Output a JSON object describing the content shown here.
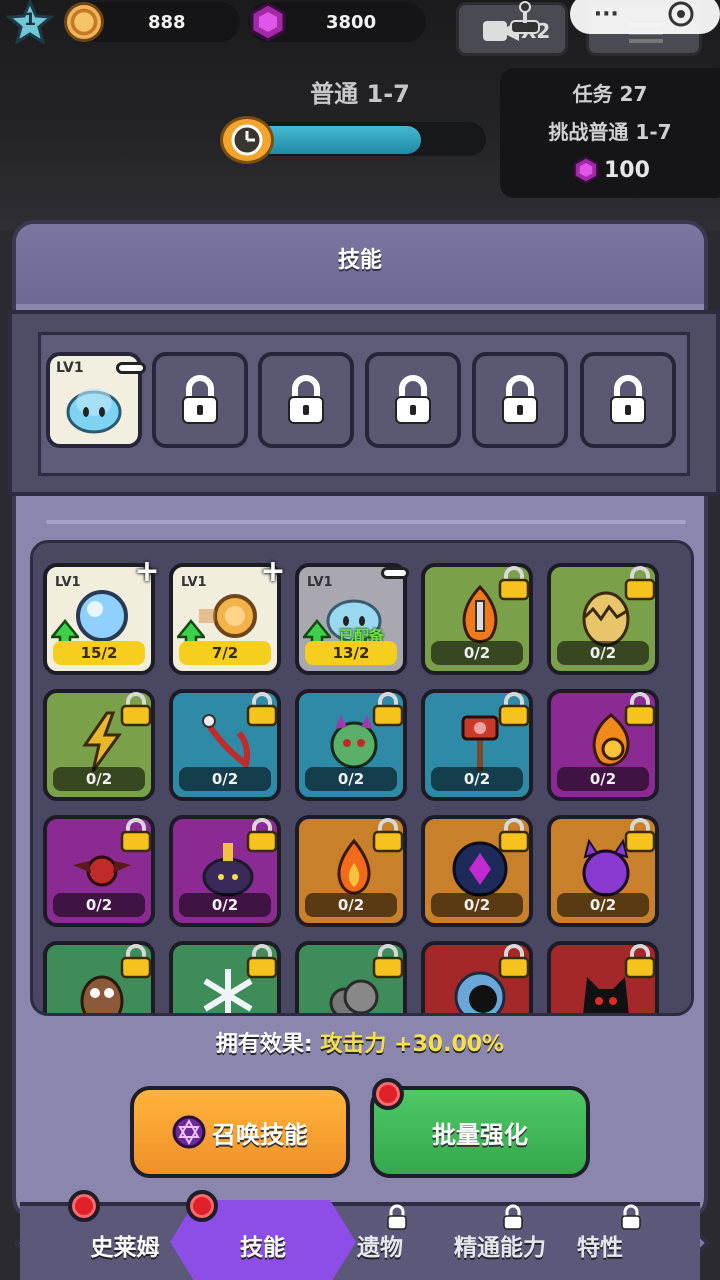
{
  "hud": {
    "level": "1",
    "coins": "888",
    "gems": "3800",
    "speed_label": "X2",
    "capsule_more": "···"
  },
  "stage": {
    "title": "普通 1-7",
    "progress": 0.78
  },
  "task": {
    "title": "任务 27",
    "desc": "挑战普通 1-7",
    "reward": "100"
  },
  "panel": {
    "title": "技能"
  },
  "equip_slots": [
    {
      "state": "filled",
      "level": "LV1",
      "icon": "slime-icon"
    },
    {
      "state": "locked",
      "icon": "lock-icon"
    },
    {
      "state": "locked",
      "icon": "lock-icon"
    },
    {
      "state": "locked",
      "icon": "lock-icon"
    },
    {
      "state": "locked",
      "icon": "lock-icon"
    },
    {
      "state": "locked",
      "icon": "lock-icon"
    }
  ],
  "skills": [
    {
      "bg": "cream",
      "level": "LV1",
      "count": "15/2",
      "icon": "water-orb-icon",
      "action": "+"
    },
    {
      "bg": "cream",
      "level": "LV1",
      "count": "7/2",
      "icon": "coin-dash-icon",
      "action": "+"
    },
    {
      "bg": "grey",
      "level": "LV1",
      "count": "13/2",
      "icon": "slime-icon",
      "action": "-",
      "tag": "已配备"
    },
    {
      "bg": "green",
      "count": "0/2",
      "icon": "flame-sword-icon",
      "locked": true
    },
    {
      "bg": "green",
      "count": "0/2",
      "icon": "cracked-egg-icon",
      "locked": true
    },
    {
      "bg": "green",
      "count": "0/2",
      "icon": "lightning-icon",
      "locked": true
    },
    {
      "bg": "teal",
      "count": "0/2",
      "icon": "chain-sickle-icon",
      "locked": true
    },
    {
      "bg": "teal",
      "count": "0/2",
      "icon": "cat-ball-icon",
      "locked": true
    },
    {
      "bg": "teal",
      "count": "0/2",
      "icon": "pig-banner-icon",
      "locked": true
    },
    {
      "bg": "purple",
      "count": "0/2",
      "icon": "fire-ring-icon",
      "locked": true
    },
    {
      "bg": "purple",
      "count": "0/2",
      "icon": "bat-icon",
      "locked": true
    },
    {
      "bg": "purple",
      "count": "0/2",
      "icon": "windup-slime-icon",
      "locked": true
    },
    {
      "bg": "orange",
      "count": "0/2",
      "icon": "fire-icon",
      "locked": true
    },
    {
      "bg": "orange",
      "count": "0/2",
      "icon": "dark-orb-icon",
      "locked": true
    },
    {
      "bg": "orange",
      "count": "0/2",
      "icon": "devil-ball-icon",
      "locked": true
    },
    {
      "bg": "forest",
      "icon": "owl-icon",
      "locked": true
    },
    {
      "bg": "forest",
      "icon": "snowflake-icon",
      "locked": true
    },
    {
      "bg": "forest",
      "icon": "smoke-icon",
      "locked": true
    },
    {
      "bg": "red",
      "icon": "black-hole-icon",
      "locked": true
    },
    {
      "bg": "red",
      "icon": "shadow-cat-icon",
      "locked": true
    }
  ],
  "effect": {
    "label": "拥有效果:",
    "value": "攻击力 +30.00%"
  },
  "buttons": {
    "summon": "召唤技能",
    "batch": "批量强化"
  },
  "nav": {
    "items": [
      {
        "label": "史莱姆",
        "badge": true
      },
      {
        "label": "技能",
        "badge": true,
        "active": true
      },
      {
        "label": "遗物",
        "locked": true
      },
      {
        "label": "精通能力",
        "locked": true
      },
      {
        "label": "特性",
        "locked": true
      }
    ]
  }
}
